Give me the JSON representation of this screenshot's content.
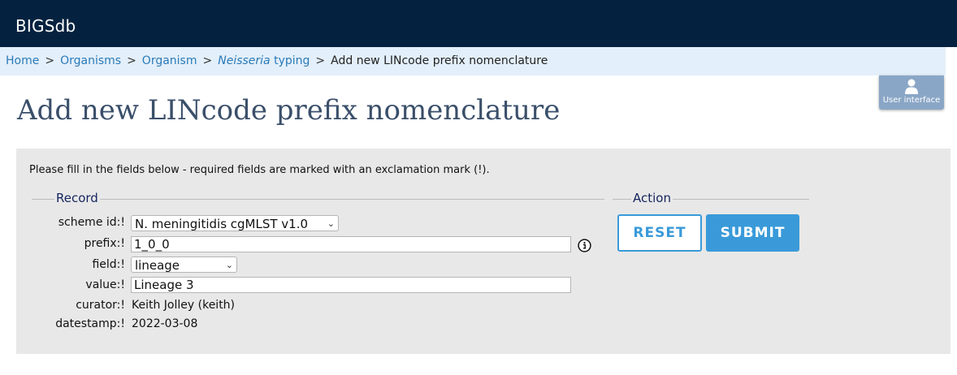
{
  "header": {
    "brand": "BIGSdb"
  },
  "breadcrumb": {
    "items": [
      {
        "label": "Home"
      },
      {
        "label": "Organisms"
      },
      {
        "label": "Organism"
      },
      {
        "label_em": "Neisseria",
        "label_rest": " typing"
      }
    ],
    "separator": ">",
    "current": "Add new LINcode prefix nomenclature"
  },
  "user_interface_button": {
    "label": "User interface",
    "icon": "user-icon"
  },
  "page_title": "Add new LINcode prefix nomenclature",
  "form": {
    "instructions": "Please fill in the fields below - required fields are marked with an exclamation mark (!).",
    "record_legend": "Record",
    "action_legend": "Action",
    "fields": {
      "scheme_id": {
        "label": "scheme id:!",
        "value": "N. meningitidis cgMLST v1.0"
      },
      "prefix": {
        "label": "prefix:!",
        "value": "1_0_0"
      },
      "field": {
        "label": "field:!",
        "value": "lineage"
      },
      "value": {
        "label": "value:!",
        "value": "Lineage 3"
      },
      "curator": {
        "label": "curator:!",
        "value": "Keith Jolley (keith)"
      },
      "datestamp": {
        "label": "datestamp:!",
        "value": "2022-03-08"
      }
    },
    "buttons": {
      "reset": "RESET",
      "submit": "SUBMIT"
    }
  },
  "colors": {
    "header_bg": "#04223f",
    "breadcrumb_bg": "#e3effa",
    "link": "#2a7ab8",
    "accent": "#3a9ad9",
    "panel_bg": "#e8e8e8",
    "title": "#3a4f6a"
  }
}
